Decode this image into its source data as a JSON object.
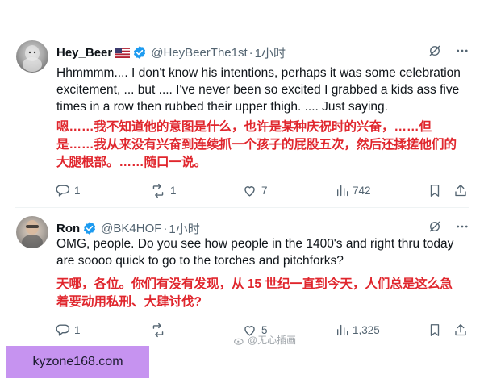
{
  "tweets": [
    {
      "display_name": "Hey_Beer",
      "handle": "@HeyBeerThe1st",
      "separator": "·",
      "time": "1小时",
      "body_en": "Hhmmmm.... I don't know his intentions, perhaps it was some celebration excitement, ... but .... I've never been so excited I grabbed a kids ass five times in a row then rubbed their upper thigh. .... Just saying.",
      "body_zh": "嗯……我不知道他的意图是什么，也许是某种庆祝时的兴奋，……但是……我从来没有兴奋到连续抓一个孩子的屁股五次，然后还揉搓他们的大腿根部。……随口一说。",
      "replies": "1",
      "retweets": "1",
      "likes": "7",
      "views": "742"
    },
    {
      "display_name": "Ron",
      "handle": "@BK4HOF",
      "separator": "·",
      "time": "1小时",
      "body_en": "OMG, people. Do you see how people in the 1400's and right thru today are soooo quick to go to the torches and pitchforks?",
      "body_zh": "天哪，各位。你们有没有发现，从 15 世纪一直到今天，人们总是这么急着要动用私刑、大肆讨伐?",
      "replies": "1",
      "retweets": "",
      "likes": "5",
      "views": "1,325"
    }
  ],
  "watermark": "@无心插画",
  "site_banner": "kyzone168.com",
  "colors": {
    "verified_blue": "#1d9bf0",
    "translation_red": "#e0262d",
    "muted_gray": "#536471",
    "banner_purple": "#c693f0"
  },
  "icons": [
    "flag-us-icon",
    "verified-badge-icon",
    "grok-icon",
    "more-icon",
    "reply-icon",
    "retweet-icon",
    "like-icon",
    "views-icon",
    "bookmark-icon",
    "share-icon"
  ]
}
